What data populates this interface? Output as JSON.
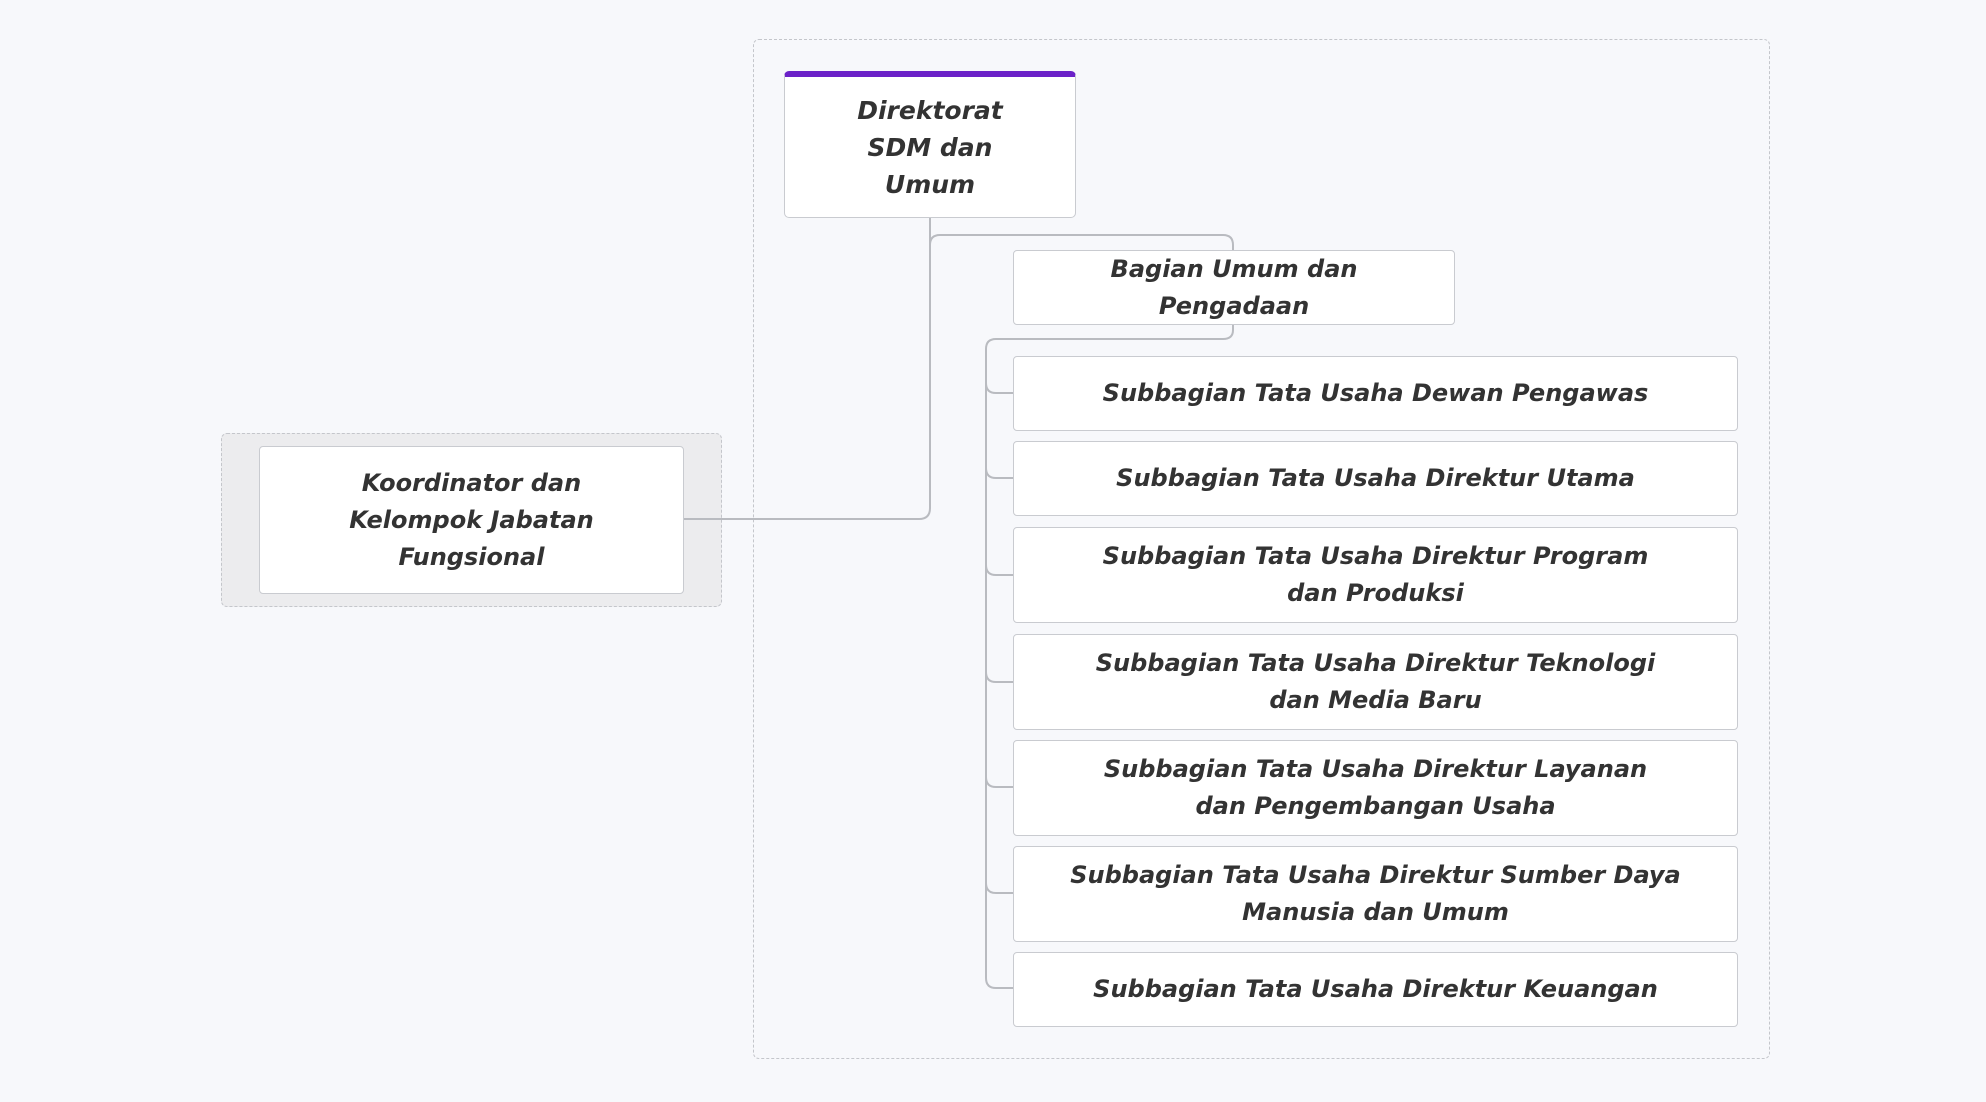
{
  "diagram": {
    "root": {
      "label": "Direktorat SDM dan Umum"
    },
    "side_unit": {
      "label": "Koordinator dan Kelompok Jabatan Fungsional"
    },
    "bagian": {
      "label": "Bagian Umum dan Pengadaan"
    },
    "subbagian": [
      {
        "label": "Subbagian Tata Usaha Dewan Pengawas"
      },
      {
        "label": "Subbagian Tata Usaha Direktur Utama"
      },
      {
        "label": "Subbagian Tata Usaha Direktur Program dan Produksi"
      },
      {
        "label": "Subbagian Tata Usaha Direktur Teknologi dan Media Baru"
      },
      {
        "label": "Subbagian Tata Usaha Direktur Layanan dan Pengembangan Usaha"
      },
      {
        "label": "Subbagian Tata Usaha Direktur Sumber Daya Manusia dan Umum"
      },
      {
        "label": "Subbagian Tata Usaha Direktur Keuangan"
      }
    ],
    "colors": {
      "root_accent": "#6b21c8",
      "connector": "#b9bbc0",
      "node_border": "#c9cbd0",
      "text": "#333333"
    }
  }
}
